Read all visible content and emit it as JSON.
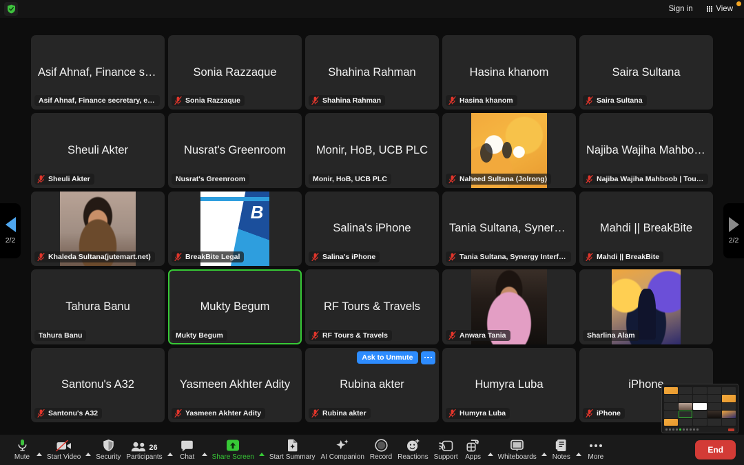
{
  "topbar": {
    "encryption_icon": "shield-check-icon",
    "sign_in_label": "Sign in",
    "view_label": "View",
    "view_icon": "grid-view-icon",
    "notification_dot_color": "#f5a623"
  },
  "gallery": {
    "page_indicator": "2/2",
    "prev_page_icon": "triangle-left-icon",
    "next_page_icon": "triangle-right-icon",
    "prev_enabled_color": "#4ea6ef",
    "next_disabled_color": "#8a8a8a",
    "active_speaker_color": "#37c936",
    "tiles": [
      {
        "big_name": "Asif Ahnaf, Finance secr...",
        "label": "Asif Ahnaf, Finance secretary, e-CAB",
        "muted": false,
        "video": false
      },
      {
        "big_name": "Sonia Razzaque",
        "label": "Sonia Razzaque",
        "muted": true,
        "video": false
      },
      {
        "big_name": "Shahina Rahman",
        "label": "Shahina Rahman",
        "muted": true,
        "video": false
      },
      {
        "big_name": "Hasina khanom",
        "label": "Hasina khanom",
        "muted": true,
        "video": false
      },
      {
        "big_name": "Saira Sultana",
        "label": "Saira Sultana",
        "muted": true,
        "video": false
      },
      {
        "big_name": "Sheuli Akter",
        "label": "Sheuli Akter",
        "muted": true,
        "video": false
      },
      {
        "big_name": "Nusrat's Greenroom",
        "label": "Nusrat's Greenroom",
        "muted": false,
        "video": false
      },
      {
        "big_name": "Monir, HoB, UCB PLC",
        "label": "Monir, HoB, UCB PLC",
        "muted": false,
        "video": false
      },
      {
        "big_name": "",
        "label": "Naheed Sultana (Jolrong)",
        "muted": true,
        "video": true,
        "art": "art-tails"
      },
      {
        "big_name": "Najiba Wajiha Mahboob...",
        "label": "Najiba Wajiha Mahboob | Toureela",
        "muted": true,
        "video": false
      },
      {
        "big_name": "",
        "label": "Khaleda Sultana(jutemart.net)",
        "muted": true,
        "video": true,
        "art": "art-khaleda"
      },
      {
        "big_name": "",
        "label": "BreakBite Legal",
        "muted": true,
        "video": true,
        "art": "art-breakbite"
      },
      {
        "big_name": "Salina's iPhone",
        "label": "Salina's iPhone",
        "muted": true,
        "video": false
      },
      {
        "big_name": "Tania Sultana, Synergy I...",
        "label": "Tania Sultana, Synergy Interface Ltd,...",
        "muted": true,
        "video": false
      },
      {
        "big_name": "Mahdi  || BreakBite",
        "label": "Mahdi  || BreakBite",
        "muted": true,
        "video": false
      },
      {
        "big_name": "Tahura Banu",
        "label": "Tahura Banu",
        "muted": false,
        "video": false
      },
      {
        "big_name": "Mukty Begum",
        "label": "Mukty Begum",
        "muted": false,
        "video": false,
        "speaking": true
      },
      {
        "big_name": "RF Tours & Travels",
        "label": "RF Tours & Travels",
        "muted": true,
        "video": false
      },
      {
        "big_name": "",
        "label": "Anwara Tania",
        "muted": true,
        "video": true,
        "art": "art-anwara"
      },
      {
        "big_name": "",
        "label": "Sharlina Alam",
        "muted": false,
        "video": true,
        "art": "art-sharlina"
      },
      {
        "big_name": "Santonu's A32",
        "label": "Santonu's A32",
        "muted": true,
        "video": false
      },
      {
        "big_name": "Yasmeen  Akhter Adity",
        "label": "Yasmeen  Akhter Adity",
        "muted": true,
        "video": false
      },
      {
        "big_name": "Rubina akter",
        "label": "Rubina akter",
        "muted": true,
        "video": false,
        "hovered": true,
        "ask_to_unmute_label": "Ask to Unmute"
      },
      {
        "big_name": "Humyra Luba",
        "label": "Humyra Luba",
        "muted": true,
        "video": false
      },
      {
        "big_name": "iPhone",
        "label": "iPhone",
        "muted": true,
        "video": false
      }
    ]
  },
  "pip": {
    "name": "screen-share-preview"
  },
  "toolbar": {
    "items": [
      {
        "label": "Mute",
        "icon": "microphone-icon",
        "caret": true
      },
      {
        "label": "Start Video",
        "icon": "video-off-icon",
        "caret": true
      },
      {
        "label": "Security",
        "icon": "shield-icon",
        "caret": false
      },
      {
        "label": "Participants",
        "icon": "participants-icon",
        "caret": true,
        "count": "26"
      },
      {
        "label": "Chat",
        "icon": "chat-bubble-icon",
        "caret": true
      },
      {
        "label": "Share Screen",
        "icon": "share-screen-icon",
        "caret": true,
        "active": true
      },
      {
        "label": "Start Summary",
        "icon": "summary-doc-icon",
        "caret": false
      },
      {
        "label": "AI Companion",
        "icon": "sparkle-icon",
        "caret": false
      },
      {
        "label": "Record",
        "icon": "record-circle-icon",
        "caret": false
      },
      {
        "label": "Reactions",
        "icon": "reactions-smiley-icon",
        "caret": false
      },
      {
        "label": "Support",
        "icon": "support-cast-icon",
        "caret": false
      },
      {
        "label": "Apps",
        "icon": "apps-icon",
        "caret": true
      },
      {
        "label": "Whiteboards",
        "icon": "whiteboard-icon",
        "caret": true
      },
      {
        "label": "Notes",
        "icon": "notes-icon",
        "caret": true
      },
      {
        "label": "More",
        "icon": "more-dots-icon",
        "caret": false
      }
    ],
    "end_label": "End",
    "end_color": "#d33b36",
    "active_color": "#37c936"
  }
}
